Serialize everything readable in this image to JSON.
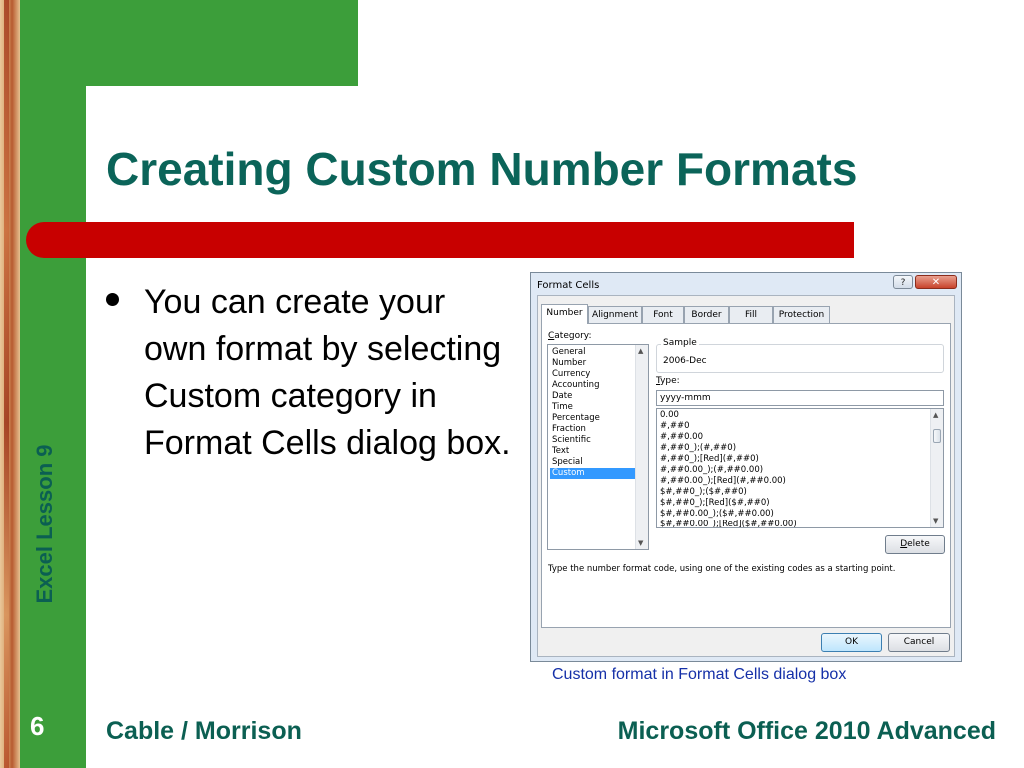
{
  "slide": {
    "title": "Creating Custom Number Formats",
    "side_label": "Excel Lesson 9",
    "bullet": "You can create your own format by selecting Custom category in Format Cells dialog box.",
    "caption": "Custom format in Format Cells dialog box",
    "page_number": "6",
    "footer_left": "Cable / Morrison",
    "footer_right": "Microsoft Office 2010 Advanced",
    "colors": {
      "green": "#3c9e3a",
      "red": "#c80000",
      "teal": "#0b6459",
      "caption": "#1530a8"
    }
  },
  "dialog": {
    "title": "Format Cells",
    "help_label": "?",
    "close_label": "✕",
    "tabs": [
      "Number",
      "Alignment",
      "Font",
      "Border",
      "Fill",
      "Protection"
    ],
    "active_tab": "Number",
    "category_label_first": "C",
    "category_label_rest": "ategory:",
    "categories": [
      "General",
      "Number",
      "Currency",
      "Accounting",
      "Date",
      "Time",
      "Percentage",
      "Fraction",
      "Scientific",
      "Text",
      "Special",
      "Custom"
    ],
    "selected_category": "Custom",
    "sample_label": "Sample",
    "sample_value": "2006-Dec",
    "type_label_first": "T",
    "type_label_rest": "ype:",
    "type_value": "yyyy-mmm",
    "formats": [
      "0.00",
      "#,##0",
      "#,##0.00",
      "#,##0_);(#,##0)",
      "#,##0_);[Red](#,##0)",
      "#,##0.00_);(#,##0.00)",
      "#,##0.00_);[Red](#,##0.00)",
      "$#,##0_);($#,##0)",
      "$#,##0_);[Red]($#,##0)",
      "$#,##0.00_);($#,##0.00)",
      "$#,##0.00_);[Red]($#,##0.00)"
    ],
    "delete_label_first": "D",
    "delete_label_rest": "elete",
    "hint": "Type the number format code, using one of the existing codes as a starting point.",
    "ok_label": "OK",
    "cancel_label": "Cancel"
  }
}
